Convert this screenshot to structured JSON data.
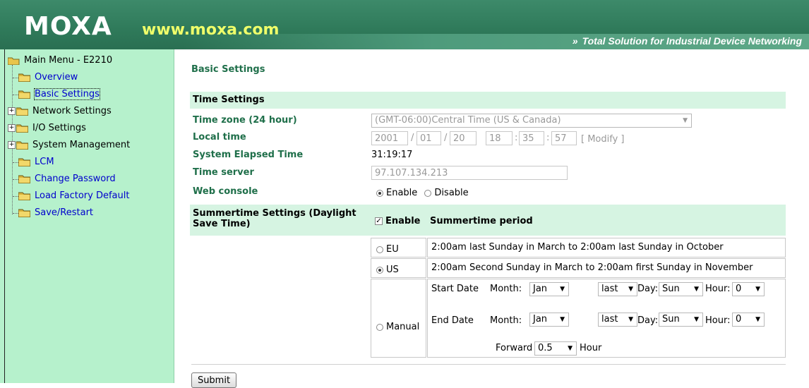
{
  "header": {
    "logo": "MOXA",
    "url": "www.moxa.com",
    "tagline_arrows": "»",
    "tagline": "Total Solution for Industrial Device Networking"
  },
  "sidebar": {
    "root": "Main Menu - E2210",
    "items": [
      {
        "label": "Overview"
      },
      {
        "label": "Basic Settings"
      },
      {
        "label": "Network Settings",
        "expander": "+"
      },
      {
        "label": "I/O Settings",
        "expander": "+"
      },
      {
        "label": "System Management",
        "expander": "+"
      },
      {
        "label": "LCM"
      },
      {
        "label": "Change Password"
      },
      {
        "label": "Load Factory Default"
      },
      {
        "label": "Save/Restart"
      }
    ]
  },
  "main": {
    "page_title": "Basic Settings",
    "time_settings": {
      "heading": "Time Settings",
      "timezone_label": "Time zone (24 hour)",
      "timezone_value": "(GMT-06:00)Central Time (US & Canada)",
      "localtime_label": "Local time",
      "year": "2001",
      "month": "01",
      "day": "20",
      "hour": "18",
      "minute": "35",
      "second": "57",
      "sep_slash": "/",
      "sep_colon": ":",
      "modify": "[ Modify ]",
      "elapsed_label": "System Elapsed Time",
      "elapsed_value": "31:19:17",
      "timeserver_label": "Time server",
      "timeserver_value": "97.107.134.213",
      "webconsole_label": "Web console",
      "enable": "Enable",
      "disable": "Disable"
    },
    "summertime": {
      "heading": "Summertime Settings  (Daylight Save Time)",
      "enable_label": "Enable",
      "period_heading": "Summertime period",
      "eu_label": "EU",
      "eu_text": "2:00am last Sunday in March to 2:00am last Sunday in October",
      "us_label": "US",
      "us_text": "2:00am Second Sunday in March to 2:00am first Sunday in November",
      "manual_label": "Manual",
      "start_date": "Start Date",
      "end_date": "End Date",
      "month_label": "Month:",
      "day_label": "Day:",
      "hour_label": "Hour:",
      "start_month": "Jan",
      "start_week": "last",
      "start_day": "Sun",
      "start_hour": "0",
      "end_month": "Jan",
      "end_week": "last",
      "end_day": "Sun",
      "end_hour": "0",
      "forward_label": "Forward",
      "forward_value": "0.5",
      "forward_unit": "Hour"
    },
    "submit": "Submit"
  }
}
